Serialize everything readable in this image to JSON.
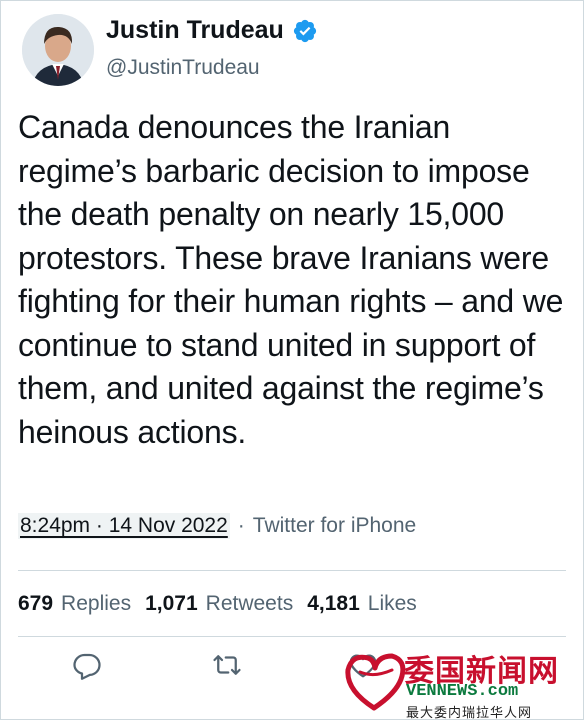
{
  "author": {
    "display_name": "Justin Trudeau",
    "handle": "@JustinTrudeau",
    "verified": true
  },
  "tweet": {
    "text": "Canada denounces the Iranian regime’s barbaric decision to impose the death penalty on nearly 15,000 protestors. These brave Iranians were fighting for their human rights – and we continue to stand united in support of them, and united against the regime’s heinous actions."
  },
  "meta": {
    "timestamp": "8:24pm · 14 Nov 2022",
    "separator": "·",
    "source": "Twitter for iPhone"
  },
  "stats": {
    "replies_count": "679",
    "replies_label": "Replies",
    "retweets_count": "1,071",
    "retweets_label": "Retweets",
    "likes_count": "4,181",
    "likes_label": "Likes"
  },
  "actions": [
    "reply-icon",
    "retweet-icon",
    "like-icon"
  ],
  "watermark": {
    "title": "委国新闻网",
    "domain": "VENNEWS.com",
    "subtitle": "最大委内瑞拉华人网"
  },
  "colors": {
    "text": "#0f1419",
    "secondary": "#536471",
    "verified": "#1d9bf0",
    "divider": "#cfd9de",
    "watermark_red": "#c8102e",
    "watermark_green": "#0b7a3e"
  }
}
